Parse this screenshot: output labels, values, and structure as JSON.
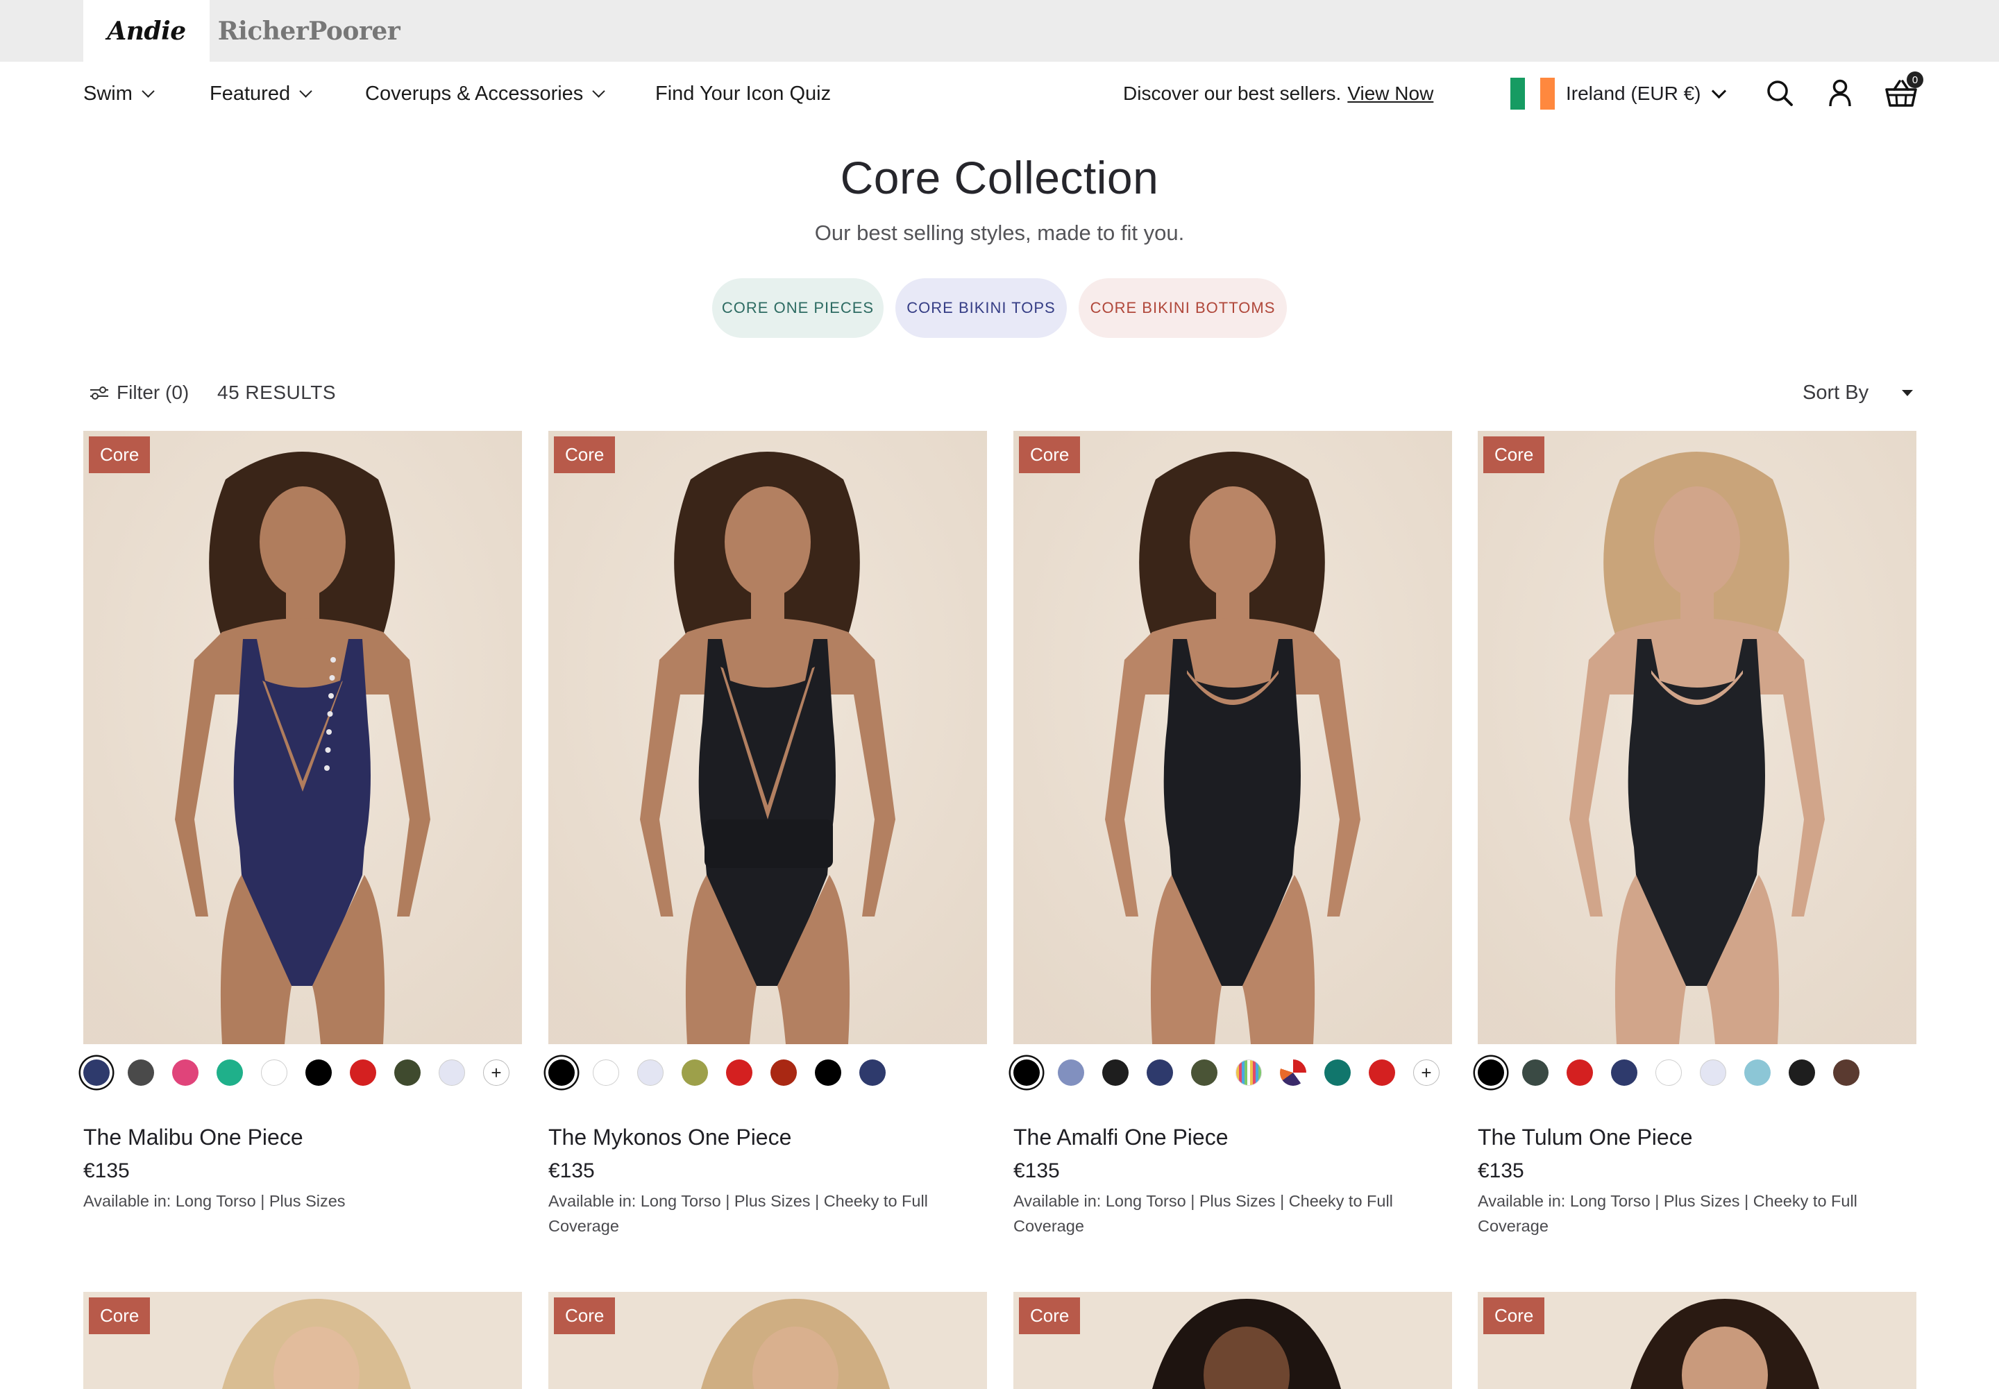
{
  "brands": [
    "Andie",
    "RicherPoorer"
  ],
  "nav": {
    "items": [
      "Swim",
      "Featured",
      "Coverups & Accessories",
      "Find Your Icon Quiz"
    ],
    "promo_text": "Discover our best sellers.",
    "promo_link": "View Now",
    "country": "Ireland (EUR €)",
    "cart_count": "0"
  },
  "hero": {
    "title": "Core Collection",
    "subtitle": "Our best selling styles, made to fit you.",
    "pills": [
      "CORE ONE PIECES",
      "CORE BIKINI TOPS",
      "CORE BIKINI BOTTOMS"
    ]
  },
  "toolbar": {
    "filter_label": "Filter (0)",
    "results_label": "45 RESULTS",
    "sort_label": "Sort By"
  },
  "products": [
    {
      "badge": "Core",
      "name": "The Malibu One Piece",
      "price": "€135",
      "availability": "Available in: Long Torso | Plus Sizes",
      "suit_color": "#2b2d5e",
      "skin": "#b07d5d",
      "swatches": [
        "#2e3a6c",
        "#4a4a4a",
        "#e0447a",
        "#1fb08a",
        "#ffffff",
        "#000000",
        "#d42020",
        "#3f4a2e",
        "#e3e5f3"
      ],
      "has_more": true
    },
    {
      "badge": "Core",
      "name": "The Mykonos One Piece",
      "price": "€135",
      "availability": "Available in: Long Torso | Plus Sizes | Cheeky to Full Coverage",
      "suit_color": "#1c1d22",
      "skin": "#b38061",
      "swatches": [
        "#000000",
        "#ffffff",
        "#e3e5f3",
        "#9da04a",
        "#d42020",
        "#a92813",
        "#000000",
        "#2e3a6c"
      ],
      "has_more": false
    },
    {
      "badge": "Core",
      "name": "The Amalfi One Piece",
      "price": "€135",
      "availability": "Available in: Long Torso | Plus Sizes | Cheeky to Full Coverage",
      "suit_color": "#1c1d22",
      "skin": "#b98566",
      "swatches": [
        "#000000",
        "#8190bf",
        "#1e1e1e",
        "#2e3a6c",
        "#4a5436",
        "stripes",
        "print",
        "#11766c",
        "#d42020"
      ],
      "has_more": true
    },
    {
      "badge": "Core",
      "name": "The Tulum One Piece",
      "price": "€135",
      "availability": "Available in: Long Torso | Plus Sizes | Cheeky to Full Coverage",
      "suit_color": "#1f2126",
      "skin": "#d1a58a",
      "swatches": [
        "#000000",
        "#3a4a44",
        "#d42020",
        "#2e3a6c",
        "#ffffff",
        "#e3e5f3",
        "#8cc6d6",
        "#1e1e1e",
        "#5a3a30"
      ],
      "has_more": false
    }
  ],
  "row2_badges": [
    "Core",
    "Core",
    "Core",
    "Core"
  ],
  "colors": {
    "badge": "#b85a4a",
    "pill_one_pieces_bg": "#e7f1ee",
    "pill_one_pieces_text": "#2d6b62",
    "pill_bikini_tops_bg": "#e8e9f7",
    "pill_bikini_tops_text": "#353d85",
    "pill_bikini_bottoms_bg": "#f8eceb",
    "pill_bikini_bottoms_text": "#b0473a",
    "photo_bg": "#ece1d4"
  }
}
